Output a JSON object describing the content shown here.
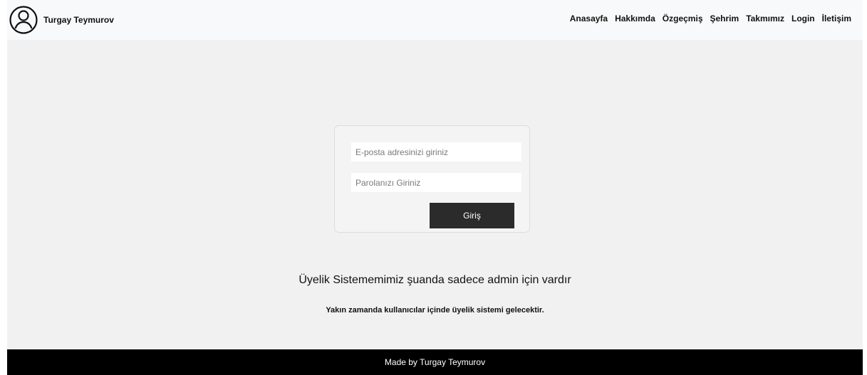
{
  "brand": {
    "name": "Turgay Teymurov",
    "icon": "user-circle-icon"
  },
  "nav": {
    "items": [
      "Anasayfa",
      "Hakkımda",
      "Özgeçmiş",
      "Şehrim",
      "Takmımız",
      "Login",
      "İletişim"
    ]
  },
  "login": {
    "email_placeholder": "E-posta adresinizi giriniz",
    "email_value": "",
    "password_placeholder": "Parolanızı Giriniz",
    "password_value": "",
    "submit_label": "Giriş"
  },
  "message": {
    "title": "Üyelik Sistememimiz şuanda sadece admin için vardır",
    "subtitle": "Yakın zamanda kullanıcılar içinde üyelik sistemi gelecektir."
  },
  "footer": {
    "text": "Made by Turgay Teymurov"
  },
  "colors": {
    "navbar_bg": "#f8f9fa",
    "page_bg": "#f1f1f1",
    "button_bg": "#2b2b2b",
    "footer_bg": "#000000"
  }
}
